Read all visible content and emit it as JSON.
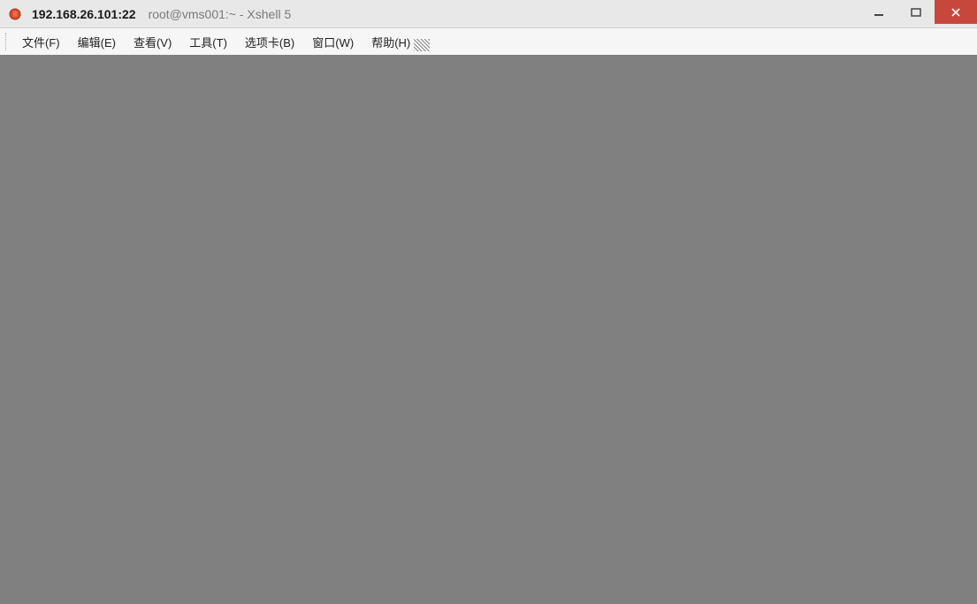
{
  "titlebar": {
    "session": "192.168.26.101:22",
    "subtitle": "root@vms001:~ - Xshell 5"
  },
  "menu": {
    "file": "文件(F)",
    "edit": "编辑(E)",
    "view": "查看(V)",
    "tools": "工具(T)",
    "tabs": "选项卡(B)",
    "window": "窗口(W)",
    "help": "帮助(H)"
  }
}
